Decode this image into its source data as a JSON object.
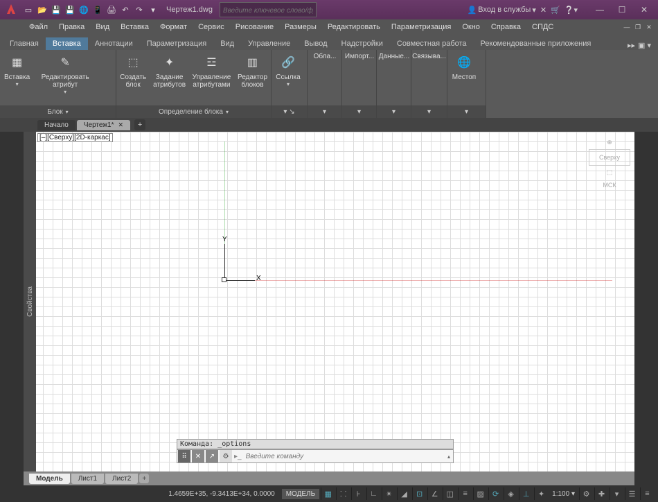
{
  "title": "Чертеж1.dwg",
  "search": {
    "placeholder": "Введите ключевое слово/фразу"
  },
  "signin": "Вход в службы",
  "menu": [
    "Файл",
    "Правка",
    "Вид",
    "Вставка",
    "Формат",
    "Сервис",
    "Рисование",
    "Размеры",
    "Редактировать",
    "Параметризация",
    "Окно",
    "Справка",
    "СПДС"
  ],
  "ribbon_tabs": [
    "Главная",
    "Вставка",
    "Аннотации",
    "Параметризация",
    "Вид",
    "Управление",
    "Вывод",
    "Надстройки",
    "Совместная работа",
    "Рекомендованные приложения"
  ],
  "ribbon_active": 1,
  "panels": {
    "block": {
      "insert": "Вставка",
      "editattr": "Редактировать\nатрибут",
      "footer": "Блок"
    },
    "blockdef": {
      "create": "Создать\nблок",
      "setattr": "Задание\nатрибутов",
      "manattr": "Управление\nатрибутами",
      "editor": "Редактор\nблоков",
      "footer": "Определение блока"
    },
    "ref": {
      "link": "Ссылка"
    },
    "narrow": [
      "Обла",
      "Импорт",
      "Данные",
      "Связыва",
      "Местоп"
    ]
  },
  "doc_tabs": {
    "start": "Начало",
    "drawing": "Чертеж1*"
  },
  "viewport_label": "[–][Сверху][2D-каркас]",
  "viewcube": {
    "top": "Сверху",
    "wcs": "МСК"
  },
  "ucs": {
    "x": "X",
    "y": "Y"
  },
  "side_panel": "Свойства",
  "cmd_history": "Команда: _options",
  "cmd_placeholder": "Введите команду",
  "layout_tabs": [
    "Модель",
    "Лист1",
    "Лист2"
  ],
  "status": {
    "coords": "1.4659E+35, -9.3413E+34, 0.0000",
    "model": "МОДЕЛЬ",
    "scale": "1:100"
  }
}
